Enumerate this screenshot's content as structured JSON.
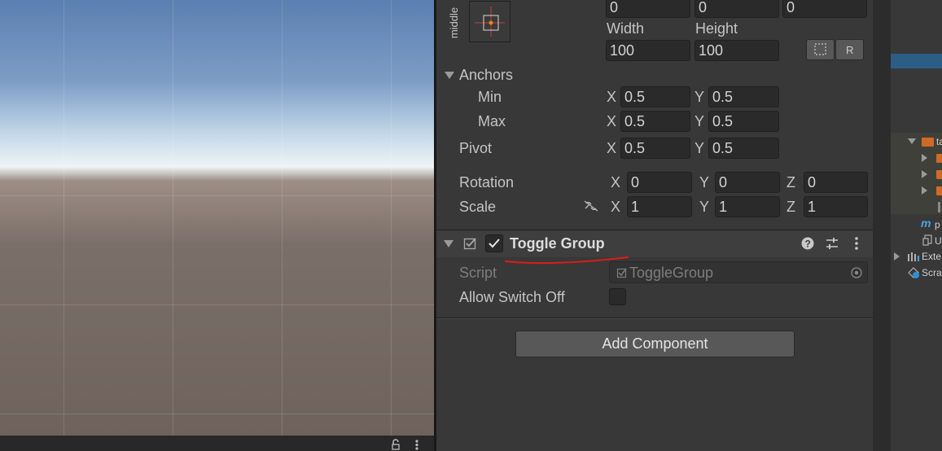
{
  "rect_transform": {
    "anchor_preset_label": "middle",
    "position_values": [
      "0",
      "0",
      "0"
    ],
    "width_label": "Width",
    "height_label": "Height",
    "width_value": "100",
    "height_value": "100",
    "anchors": {
      "label": "Anchors",
      "min_label": "Min",
      "min_x": "0.5",
      "min_y": "0.5",
      "max_label": "Max",
      "max_x": "0.5",
      "max_y": "0.5"
    },
    "pivot": {
      "label": "Pivot",
      "x": "0.5",
      "y": "0.5"
    },
    "rotation": {
      "label": "Rotation",
      "x": "0",
      "y": "0",
      "z": "0"
    },
    "scale": {
      "label": "Scale",
      "x": "1",
      "y": "1",
      "z": "1"
    },
    "axis_labels": {
      "x": "X",
      "y": "Y",
      "z": "Z"
    }
  },
  "toggle_group": {
    "title": "Toggle Group",
    "enabled": true,
    "script_label": "Script",
    "script_value": "ToggleGroup",
    "allow_switch_off_label": "Allow Switch Off",
    "allow_switch_off": false
  },
  "add_component_label": "Add Component",
  "hierarchy": {
    "items": [
      {
        "label": "ta",
        "icon": "folder-icon"
      },
      {
        "label": "",
        "icon": "folder-icon"
      },
      {
        "label": "",
        "icon": "folder-icon"
      },
      {
        "label": "",
        "icon": "folder-icon"
      },
      {
        "label": "p",
        "icon": "m-script-icon"
      },
      {
        "label": "U",
        "icon": "asset-icon"
      },
      {
        "label": "Exte",
        "icon": "bars-icon"
      },
      {
        "label": "Scra",
        "icon": "scratch-icon"
      }
    ]
  },
  "colors": {
    "annotation_underline": "#d11f1f",
    "anchor_marker": "#e8821e",
    "selection_highlight": "#2c5d87",
    "folder_color": "#d06a27"
  }
}
